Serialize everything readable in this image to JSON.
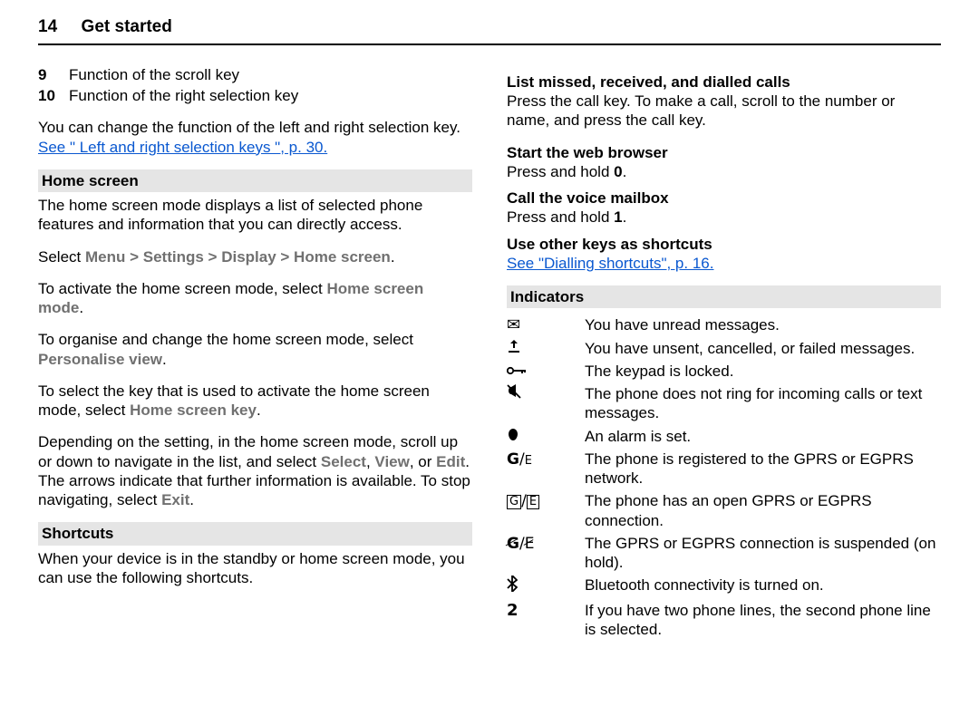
{
  "header": {
    "page_no": "14",
    "section": "Get started"
  },
  "left": {
    "items": [
      {
        "n": "9",
        "t": "Function of the scroll key"
      },
      {
        "n": "10",
        "t": "Function of the right selection key"
      }
    ],
    "change_keys_lead": "You can change the function of the left and right selection key. ",
    "change_keys_link": "See \" Left and right selection keys \", p. 30.",
    "home_screen_bar": "Home screen",
    "home_desc": "The home screen mode displays a list of selected phone features and information that you can directly access.",
    "path_lead": "Select ",
    "path_menu": "Menu",
    "sep": " > ",
    "path_settings": "Settings",
    "path_display": "Display",
    "path_home": "Home screen",
    "activate_lead": "To activate the home screen mode, select ",
    "activate_k1": "Home screen mode",
    "organise_lead": "To organise and change the home screen mode, select ",
    "organise_k": "Personalise view",
    "selectkey_lead": "To select the key that is used to activate the home screen mode, select ",
    "selectkey_k": "Home screen key",
    "nav_lead": "Depending on the setting, in the home screen mode, scroll up or down to navigate in the list, and select ",
    "nav_k1": "Select",
    "nav_c": ", ",
    "nav_k2": "View",
    "nav_or": ", or ",
    "nav_k3": "Edit",
    "nav_after": ". The arrows indicate that further information is available. To stop navigating, select ",
    "nav_k4": "Exit",
    "shortcuts_bar": "Shortcuts",
    "shortcuts_desc": "When your device is in the standby or home screen mode, you can use the following shortcuts."
  },
  "right": {
    "h_missed": "List missed, received, and dialled calls",
    "t_missed": "Press the call key. To make a call, scroll to the number or name, and press the call key.",
    "h_browser": "Start the web browser",
    "t_browser_a": "Press and hold ",
    "t_browser_k": "0",
    "h_vmail": "Call the voice mailbox",
    "t_vmail_a": "Press and hold ",
    "t_vmail_k": "1",
    "h_other": "Use other keys as shortcuts",
    "link_dial": "See \"Dialling shortcuts\", p. 16.",
    "indicators_bar": "Indicators",
    "ind": [
      {
        "icon": "envelope",
        "t": "You have unread messages."
      },
      {
        "icon": "outbox",
        "t": "You have unsent, cancelled, or failed messages."
      },
      {
        "icon": "key",
        "t": "The keypad is locked."
      },
      {
        "icon": "silent",
        "t": "The phone does not ring for incoming calls or text messages."
      },
      {
        "icon": "alarm",
        "t": "An alarm is set."
      },
      {
        "icon": "ge",
        "t": "The phone is registered to the GPRS or EGPRS network."
      },
      {
        "icon": "gebox",
        "t": "The phone has an open GPRS or EGPRS connection."
      },
      {
        "icon": "gestrike",
        "t": "The GPRS or EGPRS connection is suspended (on hold)."
      },
      {
        "icon": "bt",
        "t": "Bluetooth connectivity is turned on."
      },
      {
        "icon": "two",
        "t": "If you have two phone lines, the second phone line is selected."
      }
    ]
  }
}
